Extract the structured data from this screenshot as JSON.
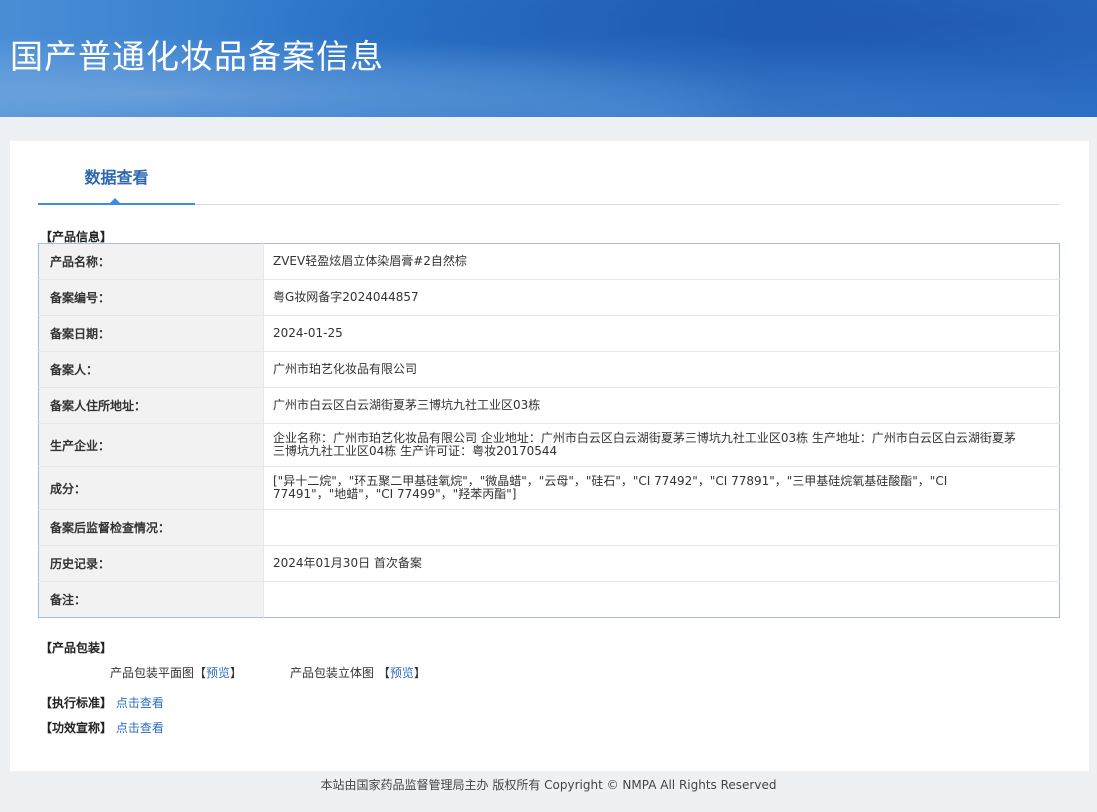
{
  "header": {
    "title": "国产普通化妆品备案信息"
  },
  "tabs": [
    {
      "label": "数据查看"
    }
  ],
  "product_section": {
    "label": "【产品信息】"
  },
  "product_rows": [
    {
      "key": "产品名称：",
      "value": "ZVEV轻盈炫眉立体染眉膏#2自然棕"
    },
    {
      "key": "备案编号：",
      "value": "粤G妆网备字2024044857"
    },
    {
      "key": "备案日期：",
      "value": "2024-01-25"
    },
    {
      "key": "备案人：",
      "value": "广州市珀艺化妆品有限公司"
    },
    {
      "key": "备案人住所地址：",
      "value": "广州市白云区白云湖街夏茅三博坑九社工业区03栋"
    },
    {
      "key": "生产企业：",
      "value": "企业名称：广州市珀艺化妆品有限公司 企业地址：广州市白云区白云湖街夏茅三博坑九社工业区03栋 生产地址：广州市白云区白云湖街夏茅三博坑九社工业区04栋 生产许可证：粤妆20170544"
    },
    {
      "key": "成分：",
      "value": "[\"异十二烷\"，\"环五聚二甲基硅氧烷\"，\"微晶蜡\"，\"云母\"，\"硅石\"，\"CI 77492\"，\"CI 77891\"，\"三甲基硅烷氧基硅酸酯\"，\"CI 77491\"，\"地蜡\"，\"CI 77499\"，\"羟苯丙酯\"]"
    },
    {
      "key": "备案后监督检查情况：",
      "value": ""
    },
    {
      "key": "历史记录：",
      "value": "2024年01月30日 首次备案"
    },
    {
      "key": "备注：",
      "value": ""
    }
  ],
  "packaging": {
    "label": "【产品包装】",
    "flat": {
      "text": "产品包装平面图",
      "open": "【",
      "link": "预览",
      "close": "】"
    },
    "solid": {
      "text": "产品包装立体图 ",
      "open": "【",
      "link": "预览",
      "close": "】"
    }
  },
  "standard": {
    "label": "【执行标准】",
    "link": "点击查看"
  },
  "efficacy": {
    "label": "【功效宣称】",
    "link": "点击查看"
  },
  "footer": {
    "text": "本站由国家药品监督管理局主办 版权所有 Copyright © NMPA All Rights Reserved"
  },
  "colors": {
    "banner": "#2a74c8",
    "tab_accent": "#3a8ee6",
    "link": "#2d6fbf"
  }
}
